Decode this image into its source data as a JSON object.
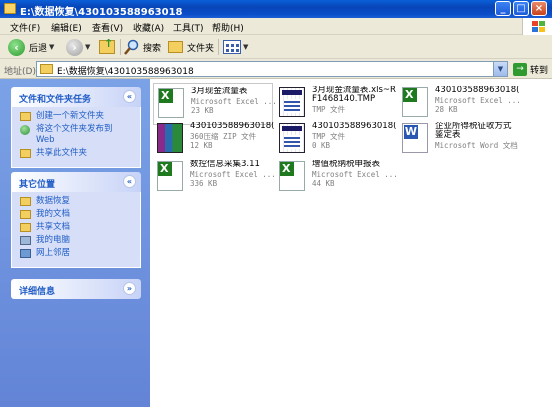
{
  "window": {
    "title": "E:\\数据恢复\\430103588963018",
    "minimize": "_",
    "maximize": "□",
    "close": "×"
  },
  "menu": [
    "文件(F)",
    "编辑(E)",
    "查看(V)",
    "收藏(A)",
    "工具(T)",
    "帮助(H)"
  ],
  "toolbar": {
    "back": "后退",
    "search": "搜索",
    "folders": "文件夹"
  },
  "address": {
    "label": "地址(D)",
    "value": "E:\\数据恢复\\430103588963018",
    "go": "转到"
  },
  "sidebar": {
    "tasks": {
      "title": "文件和文件夹任务",
      "items": [
        {
          "label": "创建一个新文件夹",
          "icon": "new-folder-icon"
        },
        {
          "label": "将这个文件夹发布到",
          "sub": "Web",
          "icon": "globe-icon"
        },
        {
          "label": "共享此文件夹",
          "icon": "share-folder-icon"
        }
      ]
    },
    "places": {
      "title": "其它位置",
      "items": [
        {
          "label": "数据恢复",
          "icon": "folder-icon"
        },
        {
          "label": "我的文档",
          "icon": "folder-icon"
        },
        {
          "label": "共享文档",
          "icon": "folder-icon"
        },
        {
          "label": "我的电脑",
          "icon": "computer-icon"
        },
        {
          "label": "网上邻居",
          "icon": "network-icon"
        }
      ]
    },
    "details": {
      "title": "详细信息"
    }
  },
  "files": [
    {
      "name": "3月现金流量表",
      "type": "Microsoft Excel ...",
      "size": "23 KB",
      "icon": "excel-icon"
    },
    {
      "name": "3月现金流量表.xls~RF1468140.TMP",
      "type": "TMP 文件",
      "size": "",
      "icon": "tmp-icon"
    },
    {
      "name": "430103588963018(...",
      "type": "Microsoft Excel ...",
      "size": "28 KB",
      "icon": "excel-icon"
    },
    {
      "name": "430103588963018(...",
      "type": "360压缩 ZIP 文件",
      "size": "12 KB",
      "icon": "zip-icon"
    },
    {
      "name": "430103588963018(...",
      "type": "TMP 文件",
      "size": "0 KB",
      "icon": "tmp-icon"
    },
    {
      "name": "企业所得税征收方式鉴定表",
      "type": "Microsoft Word 文档",
      "size": "",
      "icon": "word-icon"
    },
    {
      "name": "数控信息采集3.11",
      "type": "Microsoft Excel ...",
      "size": "336 KB",
      "icon": "excel-icon"
    },
    {
      "name": "增值税纳税申报表",
      "type": "Microsoft Excel ...",
      "size": "44 KB",
      "icon": "excel-icon"
    }
  ]
}
